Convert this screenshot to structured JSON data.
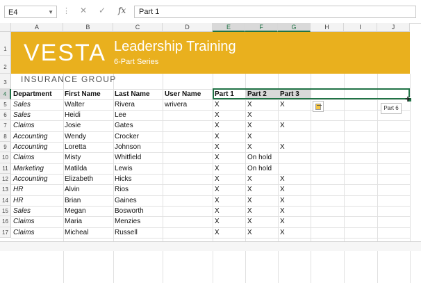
{
  "formula_bar": {
    "name_box": "E4",
    "cancel_symbol": "✕",
    "enter_symbol": "✓",
    "fx_label": "fx",
    "content": "Part 1"
  },
  "columns": [
    "A",
    "B",
    "C",
    "D",
    "E",
    "F",
    "G",
    "H",
    "I",
    "J"
  ],
  "selected_columns": [
    "E",
    "F",
    "G"
  ],
  "rows": [
    "1",
    "2",
    "3",
    "4",
    "5",
    "6",
    "7",
    "8",
    "9",
    "10",
    "11",
    "12",
    "13",
    "14",
    "15",
    "16",
    "17"
  ],
  "banner": {
    "logo": "VESTA",
    "title": "Leadership Training",
    "subtitle": "6-Part Series",
    "tagline": "INSURANCE GROUP",
    "color": "#e9b01e"
  },
  "headers": [
    "Department",
    "First Name",
    "Last Name",
    "User Name",
    "Part 1",
    "Part 2",
    "Part 3"
  ],
  "data_rows": [
    [
      "Sales",
      "Walter",
      "Rivera",
      "wrivera",
      "X",
      "X",
      "X"
    ],
    [
      "Sales",
      "Heidi",
      "Lee",
      "",
      "X",
      "X",
      ""
    ],
    [
      "Claims",
      "Josie",
      "Gates",
      "",
      "X",
      "X",
      "X"
    ],
    [
      "Accounting",
      "Wendy",
      "Crocker",
      "",
      "X",
      "X",
      ""
    ],
    [
      "Accounting",
      "Loretta",
      "Johnson",
      "",
      "X",
      "X",
      "X"
    ],
    [
      "Claims",
      "Misty",
      "Whitfield",
      "",
      "X",
      "On hold",
      ""
    ],
    [
      "Marketing",
      "Matilda",
      "Lewis",
      "",
      "X",
      "On hold",
      ""
    ],
    [
      "Accounting",
      "Elizabeth",
      "Hicks",
      "",
      "X",
      "X",
      "X"
    ],
    [
      "HR",
      "Alvin",
      "Rios",
      "",
      "X",
      "X",
      "X"
    ],
    [
      "HR",
      "Brian",
      "Gaines",
      "",
      "X",
      "X",
      "X"
    ],
    [
      "Sales",
      "Megan",
      "Bosworth",
      "",
      "X",
      "X",
      "X"
    ],
    [
      "Claims",
      "Maria",
      "Menzies",
      "",
      "X",
      "X",
      "X"
    ],
    [
      "Claims",
      "Micheal",
      "Russell",
      "",
      "X",
      "X",
      "X"
    ]
  ],
  "autofill_tooltip": "Part 6",
  "accent_color": "#217346"
}
